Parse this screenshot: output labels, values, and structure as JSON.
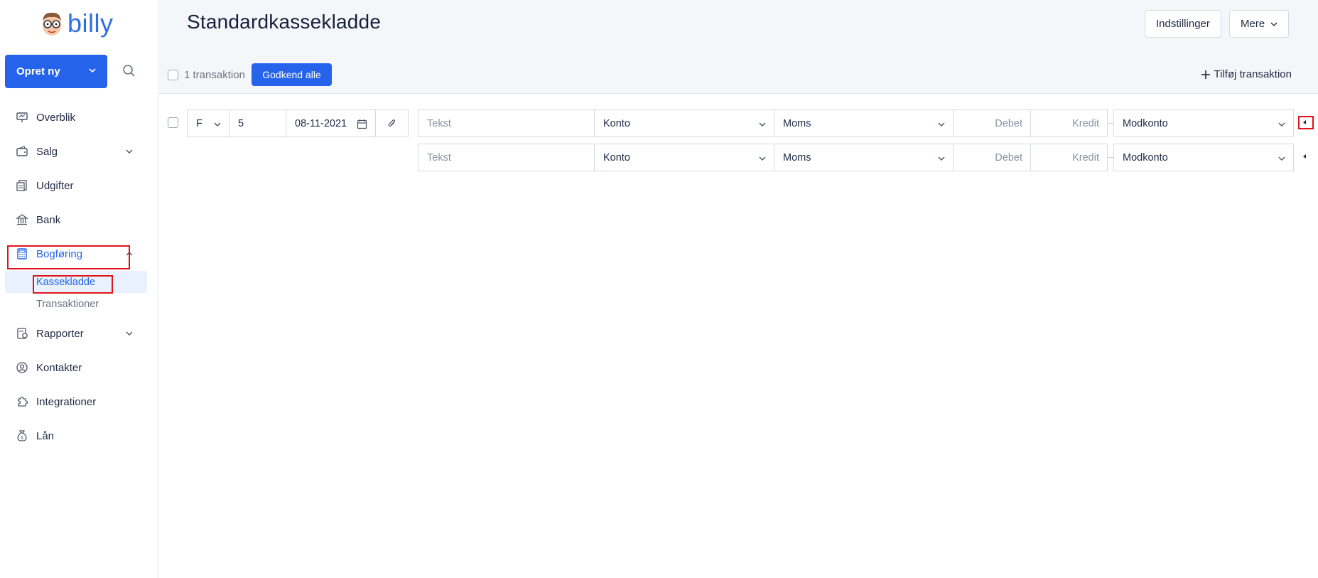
{
  "app": {
    "logo_text": "billy",
    "create_button": "Opret ny"
  },
  "sidebar": {
    "items": [
      {
        "label": "Overblik",
        "icon": "presentation-icon"
      },
      {
        "label": "Salg",
        "icon": "wallet-icon"
      },
      {
        "label": "Udgifter",
        "icon": "receipts-icon"
      },
      {
        "label": "Bank",
        "icon": "bank-icon"
      },
      {
        "label": "Bogføring",
        "icon": "calculator-icon"
      },
      {
        "label": "Rapporter",
        "icon": "report-icon"
      },
      {
        "label": "Kontakter",
        "icon": "contact-icon"
      },
      {
        "label": "Integrationer",
        "icon": "puzzle-icon"
      },
      {
        "label": "Lån",
        "icon": "money-bag-icon"
      }
    ],
    "sub_items": [
      {
        "label": "Kassekladde"
      },
      {
        "label": "Transaktioner"
      }
    ]
  },
  "header": {
    "title": "Standardkassekladde",
    "settings_button": "Indstillinger",
    "more_button": "Mere"
  },
  "toolbar": {
    "transaction_count": "1 transaktion",
    "approve_all": "Godkend alle",
    "add_transaction": "Tilføj transaktion"
  },
  "transaction": {
    "type": "F",
    "number": "5",
    "date": "08-11-2021",
    "lines": [
      {
        "text_placeholder": "Tekst",
        "account": "Konto",
        "vat": "Moms",
        "debit_placeholder": "Debet",
        "credit_placeholder": "Kredit",
        "contra_account": "Modkonto"
      },
      {
        "text_placeholder": "Tekst",
        "account": "Konto",
        "vat": "Moms",
        "debit_placeholder": "Debet",
        "credit_placeholder": "Kredit",
        "contra_account": "Modkonto"
      }
    ]
  },
  "colors": {
    "accent": "#2563eb",
    "highlight": "#e0151b",
    "active_bg": "#e8f1fd"
  }
}
